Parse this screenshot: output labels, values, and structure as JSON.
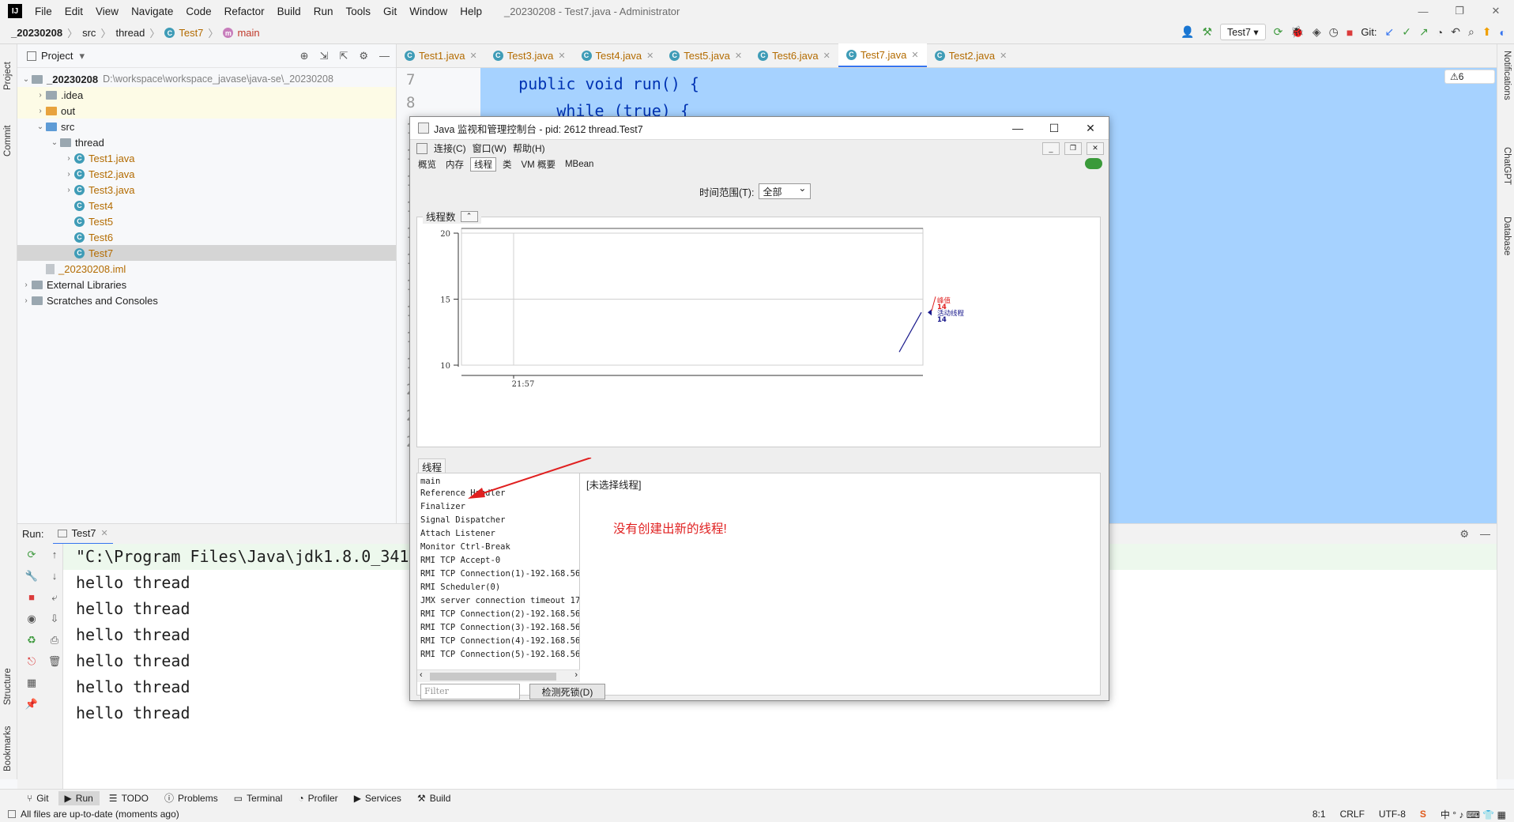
{
  "ide": {
    "logo": "IJ",
    "menu": [
      "File",
      "Edit",
      "View",
      "Navigate",
      "Code",
      "Refactor",
      "Build",
      "Run",
      "Tools",
      "Git",
      "Window",
      "Help"
    ],
    "window_title": "_20230208 - Test7.java - Administrator",
    "win_controls": [
      "—",
      "❐",
      "✕"
    ],
    "breadcrumbs": [
      "_20230208",
      "src",
      "thread",
      "Test7",
      "main"
    ],
    "run_config": "Test7",
    "git_label": "Git:"
  },
  "project": {
    "title": "Project",
    "tree": [
      {
        "label": "_20230208",
        "hint": "D:\\workspace\\workspace_javase\\java-se\\_20230208",
        "indent": 0,
        "arrow": "⌄",
        "type": "folder-grey"
      },
      {
        "label": ".idea",
        "indent": 1,
        "arrow": "›",
        "type": "folder-grey"
      },
      {
        "label": "out",
        "indent": 1,
        "arrow": "›",
        "type": "folder-orange"
      },
      {
        "label": "src",
        "indent": 1,
        "arrow": "⌄",
        "type": "folder-blue"
      },
      {
        "label": "thread",
        "indent": 2,
        "arrow": "⌄",
        "type": "folder-grey"
      },
      {
        "label": "Test1.java",
        "indent": 3,
        "arrow": "›",
        "type": "class"
      },
      {
        "label": "Test2.java",
        "indent": 3,
        "arrow": "›",
        "type": "class"
      },
      {
        "label": "Test3.java",
        "indent": 3,
        "arrow": "›",
        "type": "class"
      },
      {
        "label": "Test4",
        "indent": 3,
        "arrow": "",
        "type": "class"
      },
      {
        "label": "Test5",
        "indent": 3,
        "arrow": "",
        "type": "class"
      },
      {
        "label": "Test6",
        "indent": 3,
        "arrow": "",
        "type": "class"
      },
      {
        "label": "Test7",
        "indent": 3,
        "arrow": "",
        "type": "class",
        "selected": true
      },
      {
        "label": "_20230208.iml",
        "indent": 1,
        "arrow": "",
        "type": "file"
      },
      {
        "label": "External Libraries",
        "indent": 0,
        "arrow": "›",
        "type": "lib"
      },
      {
        "label": "Scratches and Consoles",
        "indent": 0,
        "arrow": "›",
        "type": "lib"
      }
    ]
  },
  "editor": {
    "tabs": [
      "Test1.java",
      "Test3.java",
      "Test4.java",
      "Test5.java",
      "Test6.java",
      "Test7.java",
      "Test2.java"
    ],
    "active_tab": "Test7.java",
    "gutter_lines": [
      "7",
      "8",
      "1",
      "1",
      "1",
      "1",
      "1",
      "1",
      "1",
      "1",
      "1",
      "1",
      "2",
      "2",
      "2"
    ],
    "code": [
      "    public void run() {",
      "        while (true) {"
    ],
    "warnings": "⚠6"
  },
  "left_stripe": [
    "Project",
    "Commit",
    "Structure",
    "Bookmarks"
  ],
  "right_stripe": [
    "Notifications",
    "ChatGPT",
    "Database"
  ],
  "run": {
    "label": "Run:",
    "tab": "Test7",
    "console": [
      "\"C:\\Program Files\\Java\\jdk1.8.0_341",
      "hello thread",
      "hello thread",
      "hello thread",
      "hello thread",
      "hello thread",
      "hello thread"
    ]
  },
  "bottom_tools": [
    "Git",
    "Run",
    "TODO",
    "Problems",
    "Terminal",
    "Profiler",
    "Services",
    "Build"
  ],
  "status": {
    "message": "All files are up-to-date (moments ago)",
    "position": "8:1",
    "line_sep": "CRLF",
    "encoding": "UTF-8"
  },
  "jconsole": {
    "title": "Java 监视和管理控制台 - pid: 2612 thread.Test7",
    "menu": [
      "连接(C)",
      "窗口(W)",
      "帮助(H)"
    ],
    "tabs": [
      "概览",
      "内存",
      "线程",
      "类",
      "VM 概要",
      "MBean"
    ],
    "active_tab": "线程",
    "time_range_label": "时间范围(T):",
    "time_range_value": "全部",
    "thread_count_label": "线程数",
    "threads_label": "线程",
    "thread_list": [
      "main",
      "Reference Handler",
      "Finalizer",
      "Signal Dispatcher",
      "Attach Listener",
      "Monitor Ctrl-Break",
      "RMI TCP Accept-0",
      "RMI TCP Connection(1)-192.168.56.",
      "RMI Scheduler(0)",
      "JMX server connection timeout 17",
      "RMI TCP Connection(2)-192.168.56.",
      "RMI TCP Connection(3)-192.168.56.",
      "RMI TCP Connection(4)-192.168.56.",
      "RMI TCP Connection(5)-192.168.56."
    ],
    "no_thread_selected": "[未选择线程]",
    "filter_placeholder": "Filter",
    "deadlock_button": "检测死锁(D)",
    "annotation": "没有创建出新的线程!"
  },
  "chart_data": {
    "type": "line",
    "title": "线程数",
    "x_tick_labels": [
      "21:57"
    ],
    "y_tick_labels": [
      "10",
      "15",
      "20"
    ],
    "ylim": [
      10,
      20
    ],
    "series": [
      {
        "name": "峰值",
        "color": "#e02020",
        "current": 14
      },
      {
        "name": "活动线程",
        "color": "#1a1a8c",
        "values": [
          11,
          14
        ],
        "current": 14
      }
    ],
    "legend": [
      {
        "label": "峰值",
        "value": "14",
        "color": "#e02020"
      },
      {
        "label": "活动线程",
        "value": "14",
        "color": "#1a1a8c"
      }
    ]
  }
}
